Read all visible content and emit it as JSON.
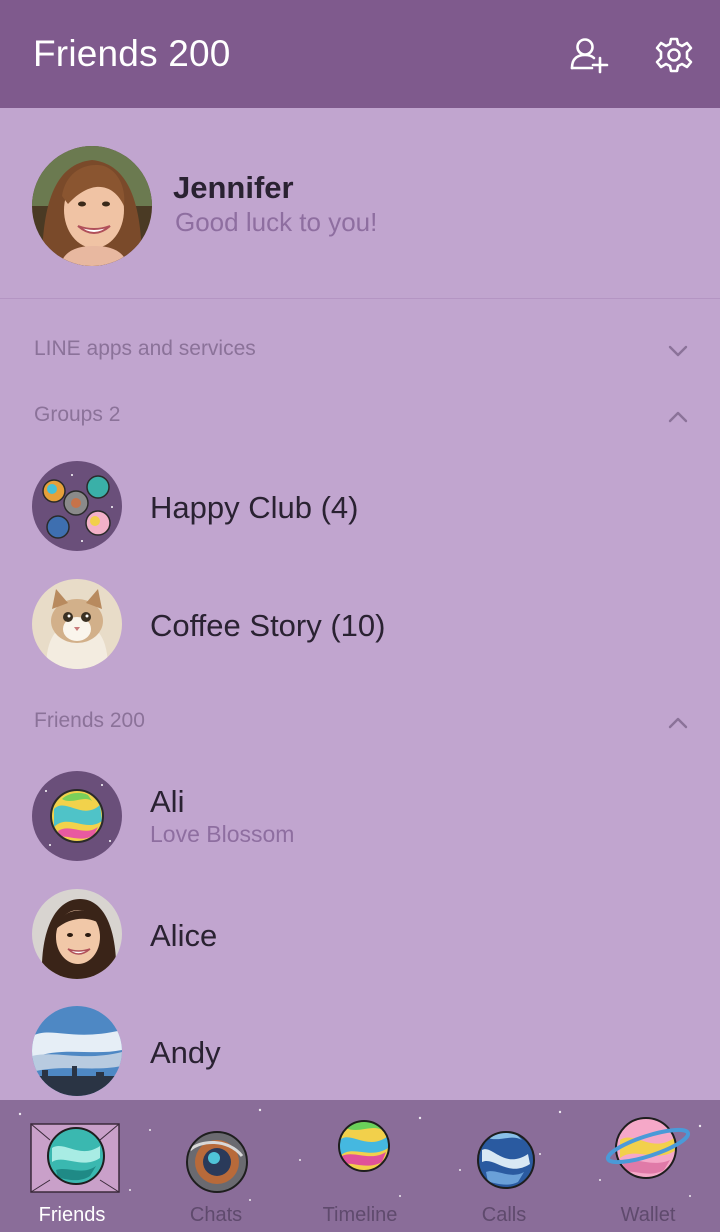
{
  "header": {
    "title": "Friends 200",
    "add_friend_icon": "add-friend-icon",
    "settings_icon": "gear-icon"
  },
  "profile": {
    "name": "Jennifer",
    "status": "Good luck to you!"
  },
  "sections": {
    "services": {
      "label": "LINE apps and services",
      "state": "collapsed"
    },
    "groups": {
      "label": "Groups 2",
      "state": "expanded"
    },
    "friends": {
      "label": "Friends 200",
      "state": "expanded"
    }
  },
  "groups": [
    {
      "name": "Happy Club (4)"
    },
    {
      "name": "Coffee Story (10)"
    }
  ],
  "friends": [
    {
      "name": "Ali",
      "status": "Love Blossom"
    },
    {
      "name": "Alice",
      "status": ""
    },
    {
      "name": "Andy",
      "status": ""
    }
  ],
  "tabs": [
    {
      "label": "Friends",
      "active": true
    },
    {
      "label": "Chats",
      "active": false
    },
    {
      "label": "Timeline",
      "active": false
    },
    {
      "label": "Calls",
      "active": false
    },
    {
      "label": "Wallet",
      "active": false
    }
  ],
  "colors": {
    "header_bg": "#7f5a8d",
    "body_bg": "#c1a5cf",
    "tabbar_bg": "#8a6d99",
    "muted_text": "#8e6ea0"
  }
}
